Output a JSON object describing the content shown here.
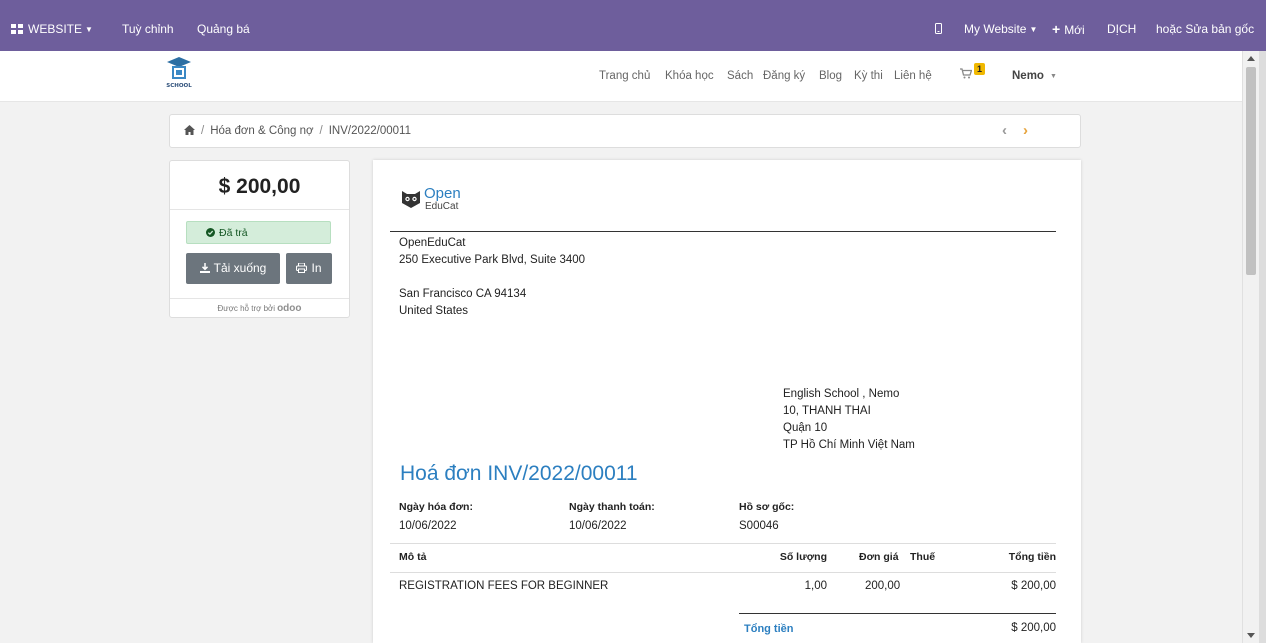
{
  "adminbar": {
    "website_label": "WEBSITE",
    "customize_label": "Tuỳ chỉnh",
    "promote_label": "Quảng bá",
    "site_selector_label": "My Website",
    "new_label": "Mới",
    "translate_label": "DỊCH",
    "edit_master_label": "hoặc Sửa bản gốc"
  },
  "header": {
    "nav": [
      "Trang chủ",
      "Khóa học",
      "Sách",
      "Đăng ký",
      "Blog",
      "Kỳ thi",
      "Liên hệ"
    ],
    "cart_count": "1",
    "user_name": "Nemo"
  },
  "breadcrumb": {
    "section": "Hóa đơn & Công nợ",
    "current": "INV/2022/00011"
  },
  "summary": {
    "amount": "$ 200,00",
    "status": "Đã trả",
    "download_label": "Tải xuống",
    "print_label": "In",
    "powered_by": "Được hỗ trợ bởi",
    "powered_brand": "odoo"
  },
  "invoice": {
    "brand_top": "Open",
    "brand_bottom": "EduCat",
    "company": [
      "OpenEduCat",
      "250 Executive Park Blvd, Suite 3400",
      "",
      "San Francisco CA 94134",
      "United States"
    ],
    "partner": [
      "English School , Nemo",
      "10, THANH THAI",
      "Quận 10",
      "TP Hồ Chí Minh Việt Nam"
    ],
    "title": "Hoá đơn INV/2022/00011",
    "info": {
      "invoice_date_label": "Ngày hóa đơn:",
      "invoice_date": "10/06/2022",
      "due_date_label": "Ngày thanh toán:",
      "due_date": "10/06/2022",
      "source_label": "Hồ sơ gốc:",
      "source": "S00046"
    },
    "columns": {
      "description": "Mô tả",
      "quantity": "Số lượng",
      "unit_price": "Đơn giá",
      "taxes": "Thuế",
      "amount": "Tổng tiền"
    },
    "line": {
      "description": "REGISTRATION FEES FOR BEGINNER",
      "quantity": "1,00",
      "unit_price": "200,00",
      "amount": "$ 200,00"
    },
    "total_label": "Tổng tiền",
    "total_value": "$ 200,00"
  },
  "colors": {
    "adminbar": "#6e5e9c",
    "accent": "#2c7fc0",
    "status_bg": "#d4edda",
    "button": "#6c757d"
  }
}
